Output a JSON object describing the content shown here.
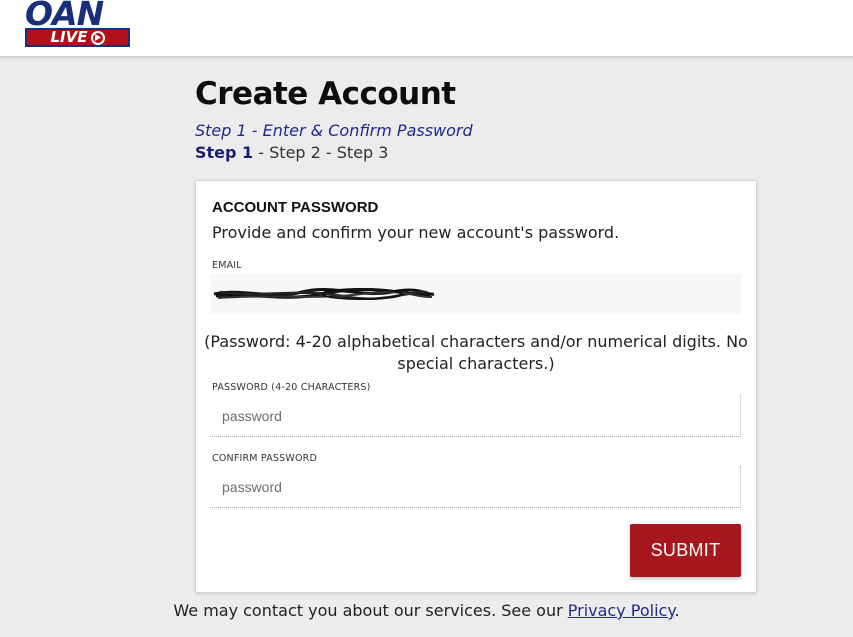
{
  "brand": {
    "logo_top": "OAN",
    "logo_bottom": "LIVE",
    "logo_icon": "play-circle-icon",
    "colors": {
      "navy": "#1a2f7a",
      "red": "#b1111b"
    }
  },
  "page": {
    "title": "Create Account",
    "step_subtitle": "Step 1 - Enter & Confirm Password",
    "steps": {
      "active": "Step 1",
      "rest": " - Step 2 - Step 3"
    }
  },
  "form": {
    "heading": "ACCOUNT PASSWORD",
    "description": "Provide and confirm your new account's password.",
    "email_label": "EMAIL",
    "email_value_redacted": true,
    "password_hint": "(Password: 4-20 alphabetical characters and/or numerical digits. No special characters.)",
    "password_label": "PASSWORD (4-20 CHARACTERS)",
    "password_placeholder": "password",
    "confirm_label": "CONFIRM PASSWORD",
    "confirm_placeholder": "password",
    "submit_label": "SUBMIT",
    "submit_color": "#a6181d"
  },
  "footer": {
    "text": "We may contact you about our services. See our ",
    "link_text": "Privacy Policy",
    "end": "."
  }
}
